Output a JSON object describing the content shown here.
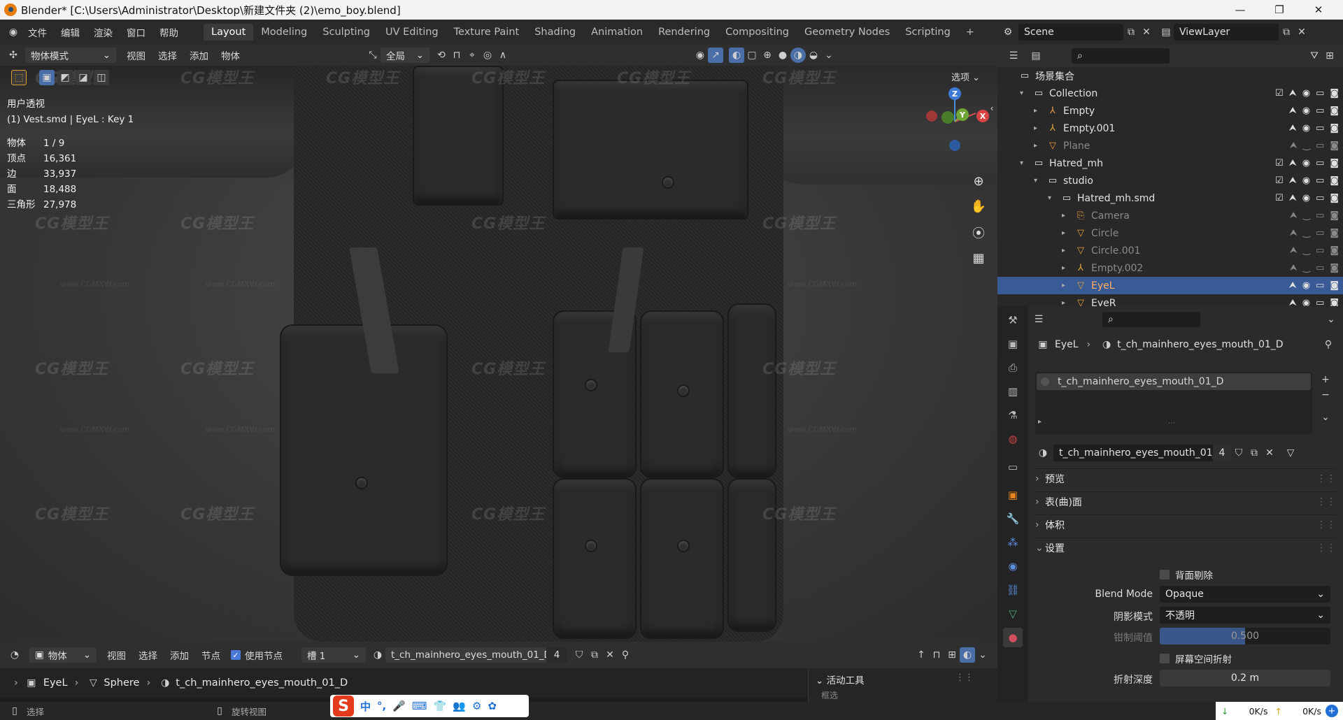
{
  "titlebar": {
    "title": "Blender* [C:\\Users\\Administrator\\Desktop\\新建文件夹 (2)\\emo_boy.blend]"
  },
  "menus": [
    "文件",
    "编辑",
    "渲染",
    "窗口",
    "帮助"
  ],
  "workspaces": [
    "Layout",
    "Modeling",
    "Sculpting",
    "UV Editing",
    "Texture Paint",
    "Shading",
    "Animation",
    "Rendering",
    "Compositing",
    "Geometry Nodes",
    "Scripting"
  ],
  "add_tab": "+",
  "scene": {
    "name": "Scene",
    "viewlayer": "ViewLayer"
  },
  "viewport_header": {
    "mode": "物体模式",
    "menus": [
      "视图",
      "选择",
      "添加",
      "物体"
    ],
    "transform_orient": "全局",
    "options": "选项"
  },
  "overlay": {
    "view_name": "用户透视",
    "object_info": "(1) Vest.smd | EyeL : Key 1",
    "stats": [
      {
        "k": "物体",
        "v": "1 / 9"
      },
      {
        "k": "顶点",
        "v": "16,361"
      },
      {
        "k": "边",
        "v": "33,937"
      },
      {
        "k": "面",
        "v": "18,488"
      },
      {
        "k": "三角形",
        "v": "27,978"
      }
    ]
  },
  "gizmo": {
    "z": "Z",
    "y": "Y",
    "x": "X"
  },
  "watermark": {
    "logo": "CG模型王",
    "url": "www.CGMXW.com"
  },
  "node_header": {
    "type": "物体",
    "menus": [
      "视图",
      "选择",
      "添加",
      "节点"
    ],
    "use_nodes": "使用节点",
    "slot": "槽 1",
    "material": "t_ch_mainhero_eyes_mouth_01_D",
    "users": "4"
  },
  "breadcrumb": {
    "obj": "EyeL",
    "mesh": "Sphere",
    "mat": "t_ch_mainhero_eyes_mouth_01_D"
  },
  "active_tool": {
    "title": "活动工具",
    "sub": "框选"
  },
  "status": {
    "select": "选择",
    "rotate": "旋转视图"
  },
  "outliner": {
    "root": "场景集合",
    "rows": [
      {
        "label": "Collection",
        "indent": 1,
        "kind": "collection"
      },
      {
        "label": "Empty",
        "indent": 2,
        "kind": "empty"
      },
      {
        "label": "Empty.001",
        "indent": 2,
        "kind": "empty"
      },
      {
        "label": "Plane",
        "indent": 2,
        "kind": "mesh",
        "dim": true
      },
      {
        "label": "Hatred_mh",
        "indent": 1,
        "kind": "collection"
      },
      {
        "label": "studio",
        "indent": 2,
        "kind": "collection"
      },
      {
        "label": "Hatred_mh.smd",
        "indent": 3,
        "kind": "collection"
      },
      {
        "label": "Camera",
        "indent": 4,
        "kind": "camera",
        "dim": true
      },
      {
        "label": "Circle",
        "indent": 4,
        "kind": "mesh",
        "dim": true
      },
      {
        "label": "Circle.001",
        "indent": 4,
        "kind": "mesh",
        "dim": true
      },
      {
        "label": "Empty.002",
        "indent": 4,
        "kind": "empty",
        "dim": true
      },
      {
        "label": "EyeL",
        "indent": 4,
        "kind": "mesh",
        "selected": true
      },
      {
        "label": "EyeR",
        "indent": 4,
        "kind": "mesh"
      }
    ]
  },
  "properties": {
    "object": "EyeL",
    "material_name": "t_ch_mainhero_eyes_mouth_01_D",
    "slot_item": "t_ch_mainhero_eyes_mouth_01_D",
    "material_field": "t_ch_mainhero_eyes_mouth_01_D",
    "users": "4",
    "sections": [
      "预览",
      "表(曲)面",
      "体积",
      "设置"
    ],
    "settings": {
      "backface": "背面剔除",
      "blend_mode_label": "Blend Mode",
      "blend_mode": "Opaque",
      "shadow_label": "阴影模式",
      "shadow": "不透明",
      "clip_label": "钳制阈值",
      "clip": "0.500",
      "clip_fraction": 0.5,
      "ssr": "屏幕空间折射",
      "refr_label": "折射深度",
      "refr": "0.2 m"
    }
  },
  "ime": {
    "items": [
      "中",
      "°,",
      "🎤",
      "⌨",
      "👕",
      "👥",
      "⚙",
      "✿"
    ]
  },
  "netspeed": {
    "down": "0K/s",
    "up": "0K/s"
  }
}
